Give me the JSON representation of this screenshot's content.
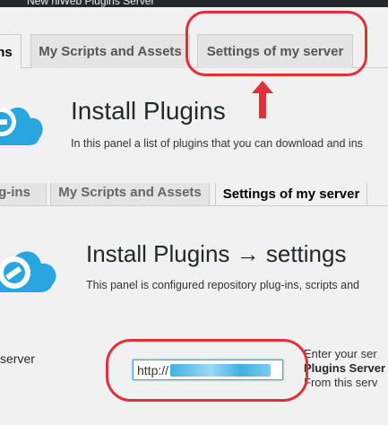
{
  "admin_bar": {
    "text": "New   hiWeb Plugins Server"
  },
  "top_panel": {
    "tabs": [
      {
        "label": "ns"
      },
      {
        "label": "My Scripts and Assets"
      },
      {
        "label": "Settings of my server"
      }
    ],
    "title": "Install Plugins",
    "description": "In this panel a list of plugins that you can download and ins"
  },
  "bottom_panel": {
    "tabs": [
      {
        "label": "g-ins"
      },
      {
        "label": "My Scripts and Assets"
      },
      {
        "label": "Settings of my server"
      }
    ],
    "title": "Install Plugins → settings",
    "description": "This panel is configured repository plug-ins, scripts and",
    "field_label": "server",
    "url_value": "http://",
    "help": {
      "line1": "Enter your ser",
      "line2": "Plugins Server",
      "line3": "From this serv"
    }
  },
  "colors": {
    "annotation": "#e0303a",
    "cloud": "#29a6df",
    "background": "#f1f1f1"
  },
  "icons": {
    "cloud": "cloud-plug-icon",
    "arrow": "arrow-up-icon"
  }
}
